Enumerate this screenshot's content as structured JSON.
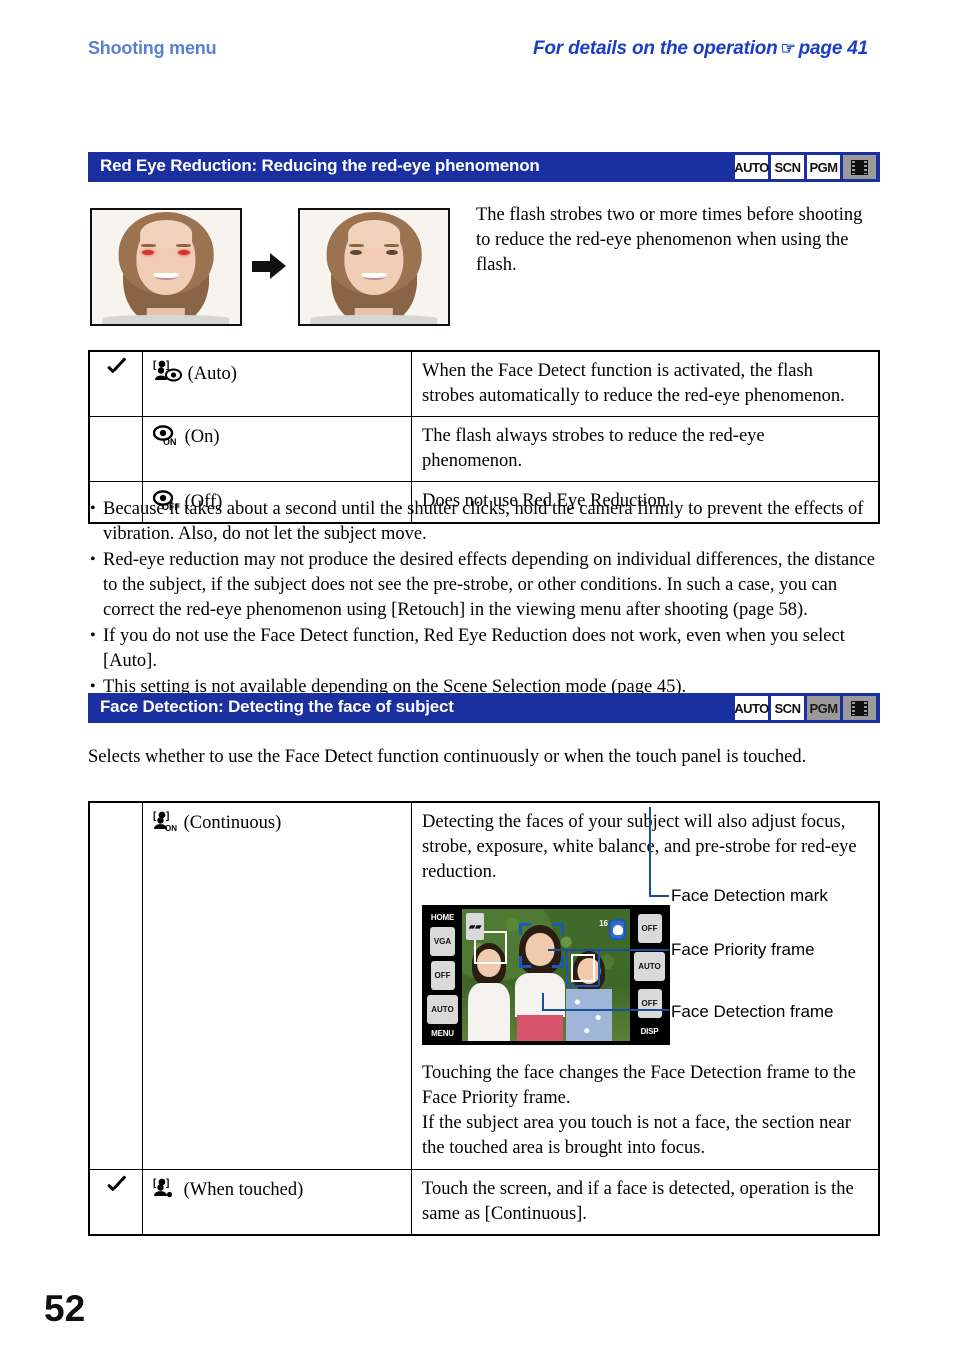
{
  "runhead": {
    "left": "Shooting menu",
    "right_text": "For details on the operation",
    "right_hand": "☞",
    "right_page": "page 41"
  },
  "sections": [
    {
      "title": "Red Eye Reduction: Reducing the red-eye phenomenon",
      "modes": [
        {
          "label": "AUTO",
          "enabled": true
        },
        {
          "label": "SCN",
          "enabled": true
        },
        {
          "label": "PGM",
          "enabled": true
        },
        {
          "label": "movie-icon",
          "enabled": true
        }
      ],
      "intro": "The flash strobes two or more times before shooting to reduce the red-eye phenomenon when using the flash.",
      "rows": [
        {
          "checked": true,
          "icon": "face-redeye-auto-icon",
          "icon_sub": "",
          "label": "(Auto)",
          "desc": "When the Face Detect function is activated, the flash strobes automatically to reduce the red-eye phenomenon."
        },
        {
          "checked": false,
          "icon": "redeye-on-icon",
          "icon_sub": "ON",
          "label": "(On)",
          "desc": "The flash always strobes to reduce the red-eye phenomenon."
        },
        {
          "checked": false,
          "icon": "redeye-off-icon",
          "icon_sub": "OFF",
          "label": "(Off)",
          "desc": "Does not use Red Eye Reduction."
        }
      ],
      "notes": [
        "Because it takes about a second until the shutter clicks, hold the camera firmly to prevent the effects of vibration. Also, do not let the subject move.",
        "Red-eye reduction may not produce the desired effects depending on individual differences, the distance to the subject, if the subject does not see the pre-strobe, or other conditions. In such a case, you can correct the red-eye phenomenon using [Retouch] in the viewing menu after shooting (page 58).",
        "If you do not use the Face Detect function, Red Eye Reduction does not work, even when you select [Auto].",
        "This setting is not available depending on the Scene Selection mode (page 45)."
      ]
    },
    {
      "title": "Face Detection: Detecting the face of subject",
      "modes": [
        {
          "label": "AUTO",
          "enabled": true
        },
        {
          "label": "SCN",
          "enabled": true
        },
        {
          "label": "PGM",
          "enabled": false
        },
        {
          "label": "movie-icon",
          "enabled": false
        }
      ],
      "intro": "Selects whether to use the Face Detect function continuously or when the touch panel is touched.",
      "rows": [
        {
          "checked": false,
          "icon": "face-detect-on-icon",
          "icon_sub": "ON",
          "label": "(Continuous)",
          "desc_top": "Detecting the faces of your subject will also adjust focus, strobe, exposure, white balance, and pre-strobe for red-eye reduction.",
          "desc_bottom_1": "Touching the face changes the Face Detection frame to the Face Priority frame.",
          "desc_bottom_2": "If the subject area you touch is not a face, the section near the touched area is brought into focus."
        },
        {
          "checked": true,
          "icon": "face-detect-touch-icon",
          "icon_sub": "",
          "label": "(When touched)",
          "desc": "Touch the screen, and if a face is detected, operation is the same as [Continuous]."
        }
      ]
    }
  ],
  "lcd": {
    "left_buttons": [
      "HOME",
      "VGA",
      "OFF",
      "AUTO",
      "MENU"
    ],
    "right_buttons": [
      "OFF",
      "AUTO",
      "OFF",
      "DISP"
    ],
    "shots_remaining": "16"
  },
  "callouts": [
    "Face Detection mark",
    "Face Priority frame",
    "Face Detection frame"
  ],
  "page_number": "52",
  "colors": {
    "header_blue": "#1a2fa0",
    "link_blue": "#1a3ec8",
    "runhead_blue": "#5a7fd6",
    "callout_leader": "#1a4e96",
    "frame_blue": "#1958b8"
  }
}
